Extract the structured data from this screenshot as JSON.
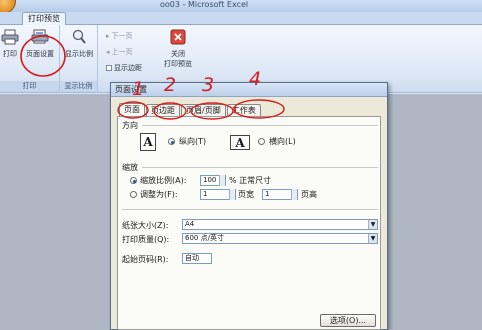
{
  "window": {
    "title": "oo03 - Microsoft Excel"
  },
  "ribbon": {
    "tab_active": "打印预览",
    "groups": [
      {
        "label": "打印"
      },
      {
        "label": "显示比例"
      }
    ],
    "print_label": "打印",
    "page_setup_label": "页面设置",
    "zoom_label": "显示比例",
    "next_page_label": "下一页",
    "prev_page_label": "上一页",
    "show_margins_label": "显示边距",
    "close_label": "关闭\n打印预览",
    "close_line1": "关闭",
    "close_line2": "打印预览"
  },
  "dialog": {
    "title": "页面设置",
    "tabs": [
      "页面",
      "页边距",
      "页眉/页脚",
      "工作表"
    ],
    "orientation": {
      "header": "方向",
      "portrait_label": "纵向(T)",
      "landscape_label": "横向(L)",
      "portrait_selected": true
    },
    "scaling": {
      "header": "缩放",
      "adjust_label": "缩放比例(A):",
      "adjust_value": "100",
      "adjust_suffix": "% 正常尺寸",
      "fit_label": "调整为(F):",
      "fit_wide_value": "1",
      "fit_wide_suffix": "页宽",
      "fit_tall_value": "1",
      "fit_tall_suffix": "页高"
    },
    "paper_size_label": "纸张大小(Z):",
    "paper_size_value": "A4",
    "print_quality_label": "打印质量(Q):",
    "print_quality_value": "600 点/英寸",
    "first_page_label": "起始页码(R):",
    "first_page_value": "自动",
    "options_button": "选项(O)..."
  },
  "annotations": [
    "1",
    "2",
    "3",
    "4"
  ],
  "colors": {
    "annotation": "#d51d1d",
    "ribbon_bg": "#dde8f6",
    "dialog_bg": "#ece9d8"
  }
}
